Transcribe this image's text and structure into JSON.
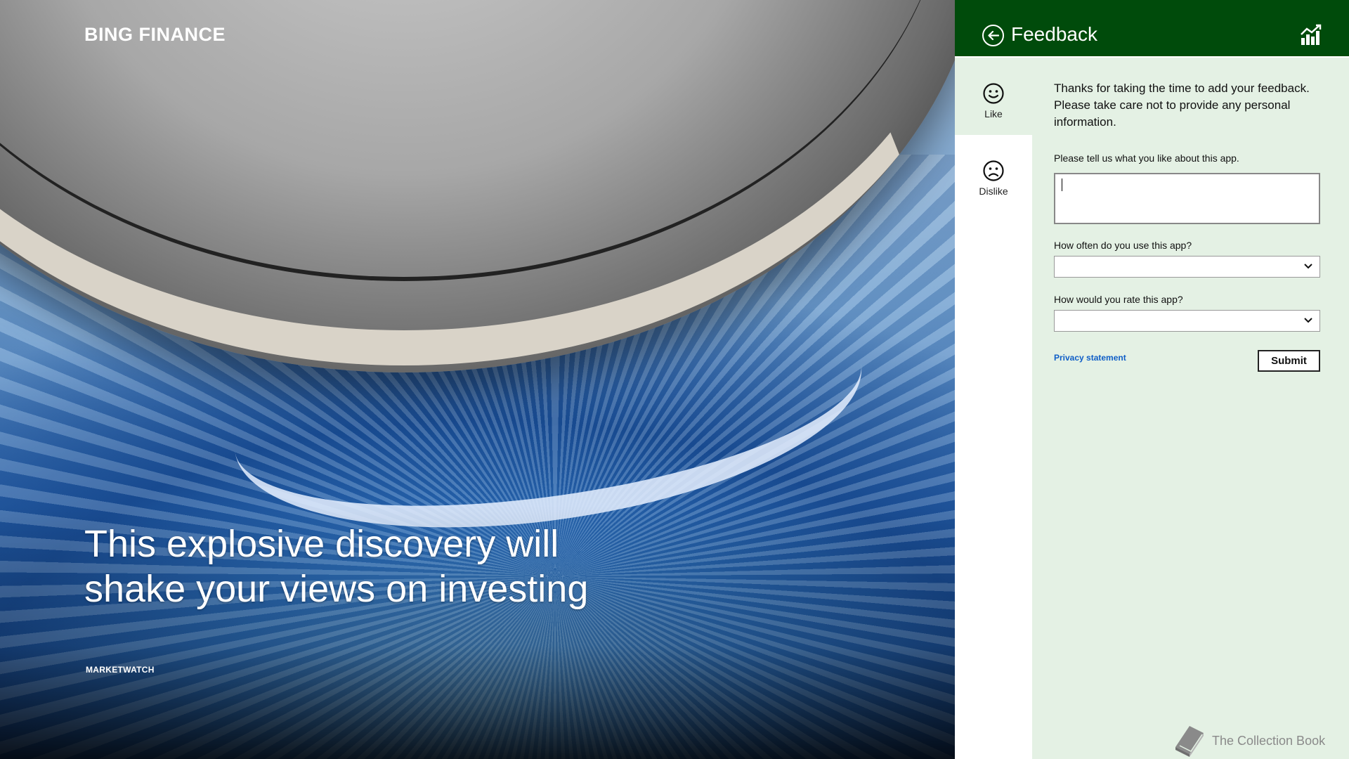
{
  "hero": {
    "brand": "BING FINANCE",
    "headline": "This explosive discovery will shake your views on investing",
    "source": "MARKETWATCH"
  },
  "panel": {
    "title": "Feedback",
    "colors": {
      "header": "#004b0b",
      "panel_bg": "#e4f1e4",
      "link": "#0f5ec7"
    },
    "nav": {
      "like_label": "Like",
      "dislike_label": "Dislike",
      "active": "like"
    },
    "intro": "Thanks for taking the time to add your feedback. Please take care not to provide any personal information.",
    "like_prompt": "Please tell us what you like about this app.",
    "like_value": "",
    "frequency_label": "How often do you use this app?",
    "frequency_value": "",
    "rating_label": "How would you rate this app?",
    "rating_value": "",
    "privacy_link": "Privacy statement",
    "submit_label": "Submit"
  },
  "watermark": {
    "text": "The Collection Book"
  },
  "icons": {
    "back": "back-arrow-circle-icon",
    "app": "finance-chart-icon",
    "like": "smiley-face-icon",
    "dislike": "frown-face-icon",
    "dropdown": "chevron-down-icon",
    "watermark": "book-icon"
  }
}
